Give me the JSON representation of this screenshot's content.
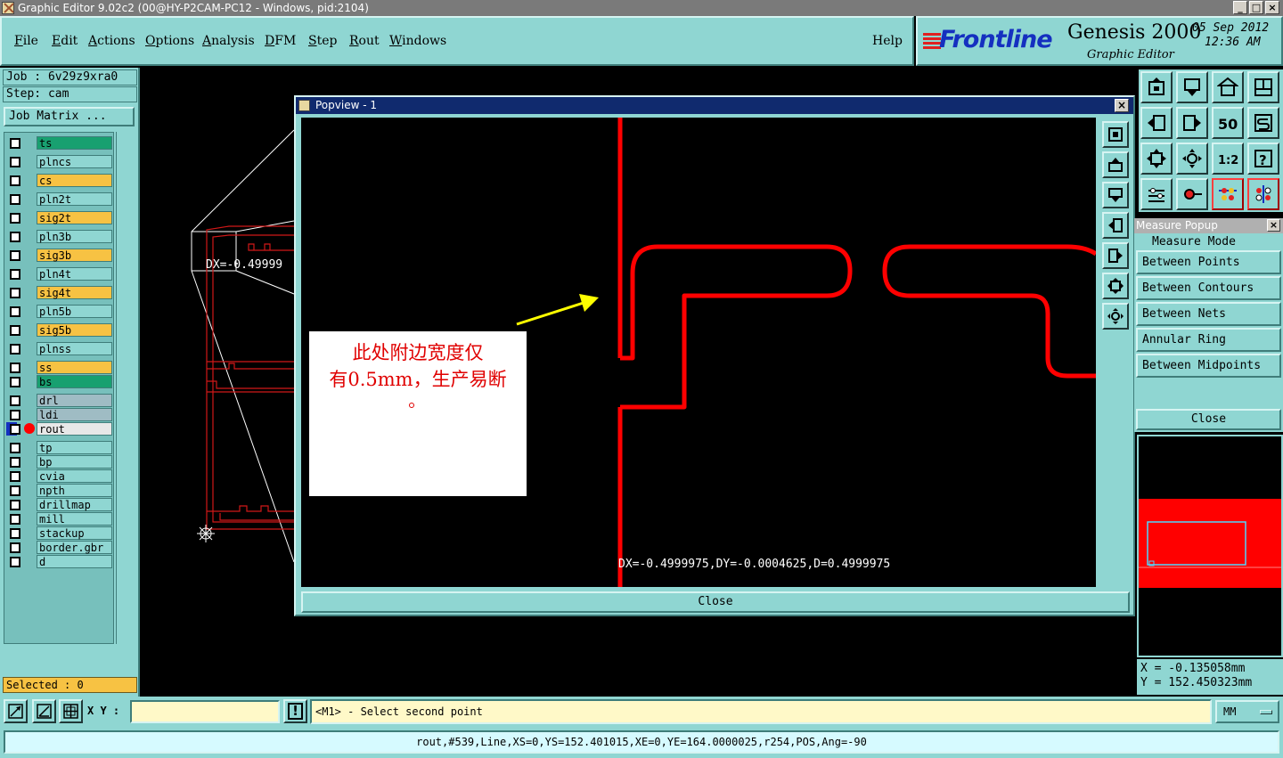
{
  "window": {
    "title": "Graphic Editor 9.02c2 (00@HY-P2CAM-PC12 - Windows, pid:2104)"
  },
  "menu": {
    "items": [
      {
        "label": "File",
        "u": "F",
        "rest": "ile"
      },
      {
        "label": "Edit",
        "u": "E",
        "rest": "dit"
      },
      {
        "label": "Actions",
        "u": "A",
        "rest": "ctions"
      },
      {
        "label": "Options",
        "u": "O",
        "rest": "ptions"
      },
      {
        "label": "Analysis",
        "u": "A",
        "rest": "nalysis"
      },
      {
        "label": "DFM",
        "u": "D",
        "rest": "FM"
      },
      {
        "label": "Step",
        "u": "S",
        "rest": "tep"
      },
      {
        "label": "Rout",
        "u": "R",
        "rest": "out"
      },
      {
        "label": "Windows",
        "u": "W",
        "rest": "indows"
      }
    ],
    "help": "Help"
  },
  "branding": {
    "brand": "Frontline",
    "product": "Genesis 2000",
    "subtitle": "Graphic Editor",
    "date": "05 Sep 2012",
    "time": "12:36 AM"
  },
  "job": {
    "job_line": "Job : 6v29z9xra0",
    "step_line": "Step: cam",
    "matrix_button": "Job Matrix ..."
  },
  "layers": [
    {
      "name": "ts",
      "color": "#18a070"
    },
    {
      "name": "plncs",
      "color": "#8fd6d2"
    },
    {
      "name": "cs",
      "color": "#f7c243"
    },
    {
      "name": "pln2t",
      "color": "#8fd6d2"
    },
    {
      "name": "sig2t",
      "color": "#f7c243"
    },
    {
      "name": "pln3b",
      "color": "#8fd6d2"
    },
    {
      "name": "sig3b",
      "color": "#f7c243"
    },
    {
      "name": "pln4t",
      "color": "#8fd6d2"
    },
    {
      "name": "sig4t",
      "color": "#f7c243"
    },
    {
      "name": "pln5b",
      "color": "#8fd6d2"
    },
    {
      "name": "sig5b",
      "color": "#f7c243"
    },
    {
      "name": "plnss",
      "color": "#8fd6d2"
    },
    {
      "name": "ss",
      "color": "#f7c243"
    },
    {
      "name": "bs",
      "color": "#18a070"
    },
    {
      "name": "drl",
      "color": "#9fbcc4"
    },
    {
      "name": "ldi",
      "color": "#9fbcc4"
    },
    {
      "name": "rout",
      "color": "#e8e8e8",
      "active": true
    },
    {
      "name": "tp",
      "color": "#8fd6d2"
    },
    {
      "name": "bp",
      "color": "#8fd6d2"
    },
    {
      "name": "cvia",
      "color": "#8fd6d2"
    },
    {
      "name": "npth",
      "color": "#8fd6d2"
    },
    {
      "name": "drillmap",
      "color": "#8fd6d2"
    },
    {
      "name": "mill",
      "color": "#8fd6d2"
    },
    {
      "name": "stackup",
      "color": "#8fd6d2"
    },
    {
      "name": "border.gbr",
      "color": "#8fd6d2"
    },
    {
      "name": "d",
      "color": "#8fd6d2"
    }
  ],
  "selected_text": "Selected : 0",
  "main_canvas": {
    "dx_text": "DX=-0.49999"
  },
  "popview": {
    "title": "Popview - 1",
    "close_label": "Close",
    "note_line1": "此处附边宽度仅",
    "note_line2": "有0.5mm，生产易断",
    "measure_text": "DX=-0.4999975,DY=-0.0004625,D=0.4999975"
  },
  "measure_popup": {
    "title": "Measure Popup",
    "mode_label": "Measure Mode",
    "options": [
      "Between Points",
      "Between Contours",
      "Between Nets",
      "Annular Ring",
      "Between Midpoints"
    ],
    "close_label": "Close"
  },
  "coordinates": {
    "x": "X  = -0.135058mm",
    "y": "Y  = 152.450323mm"
  },
  "bottom": {
    "xy_label": "X Y :",
    "xy_value": "",
    "warn_label": "!",
    "prompt": "<M1> - Select second point",
    "unit": "MM"
  },
  "status_line": "rout,#539,Line,XS=0,YS=152.401015,XE=0,YE=164.0000025,r254,POS,Ang=-90",
  "colors": {
    "panel": "#8fd6d2",
    "rout_red": "#ff0000",
    "accent_blue": "#1530c0"
  }
}
